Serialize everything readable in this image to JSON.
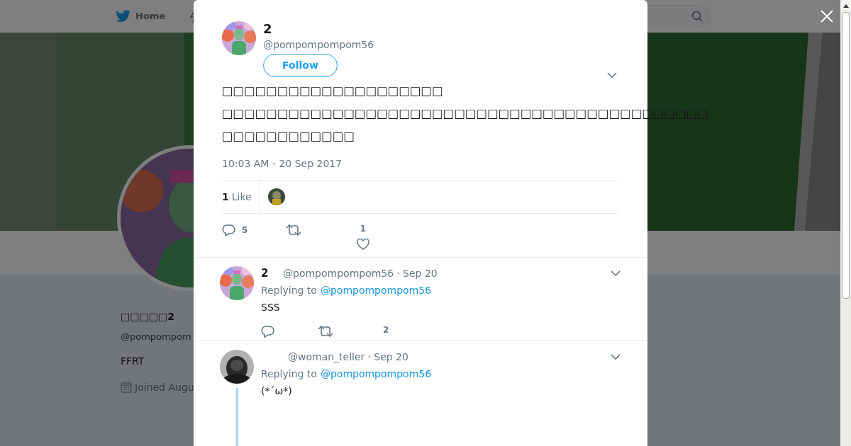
{
  "nav": {
    "home": "Home"
  },
  "profile": {
    "name": "□□□□□2",
    "handle": "@pompompom",
    "bio": "FFRT",
    "joined": "Joined Augu"
  },
  "tweet": {
    "name": "2",
    "handle": "@pompompompom56",
    "follow": "Follow",
    "text_lines": [
      "□□□□□□□□□□□□□□□□□□□□",
      "□□□□□□□□□□□□□□□□□□□□□□□□□□□□□□□□□□□□□□□□□□□□",
      "□□□□□□□□□□□□"
    ],
    "time": "10:03 AM - 20 Sep 2017",
    "likes_total": "1",
    "likes_label": "Like",
    "reply_count": "5",
    "like_count": "1"
  },
  "replies": [
    {
      "name": "2",
      "handle": "@pompompompom56",
      "date": "· Sep 20",
      "replying_label": "Replying to",
      "replying_to": "@pompompompom56",
      "text": "SSS",
      "like_count": "2",
      "thread": false
    },
    {
      "handle": "@woman_teller",
      "date": "· Sep 20",
      "replying_label": "Replying to",
      "replying_to": "@pompompompom56",
      "text": "(*´ω*)",
      "thread": true
    }
  ]
}
